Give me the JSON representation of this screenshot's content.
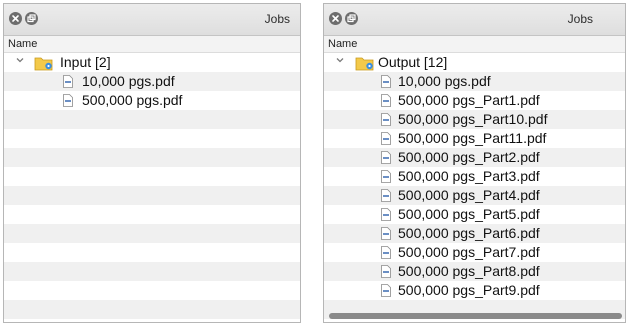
{
  "left": {
    "title": "Jobs",
    "column_header": "Name",
    "folder": {
      "label": "Input [2]"
    },
    "files": [
      "10,000 pgs.pdf",
      "500,000 pgs.pdf"
    ]
  },
  "right": {
    "title": "Jobs",
    "column_header": "Name",
    "folder": {
      "label": "Output [12]"
    },
    "files": [
      "10,000 pgs.pdf",
      "500,000 pgs_Part1.pdf",
      "500,000 pgs_Part10.pdf",
      "500,000 pgs_Part11.pdf",
      "500,000 pgs_Part2.pdf",
      "500,000 pgs_Part3.pdf",
      "500,000 pgs_Part4.pdf",
      "500,000 pgs_Part5.pdf",
      "500,000 pgs_Part6.pdf",
      "500,000 pgs_Part7.pdf",
      "500,000 pgs_Part8.pdf",
      "500,000 pgs_Part9.pdf"
    ]
  },
  "icons": {
    "close": "close-icon",
    "restore": "restore-icon",
    "disclosure": "chevron-down-icon",
    "folder": "folder-gear-icon",
    "file": "pdf-file-icon"
  },
  "colors": {
    "titlebar": "#e4e4e4",
    "stripe": "#f0f0f0",
    "folder": "#f3c94a",
    "gear": "#3b8fe0"
  }
}
